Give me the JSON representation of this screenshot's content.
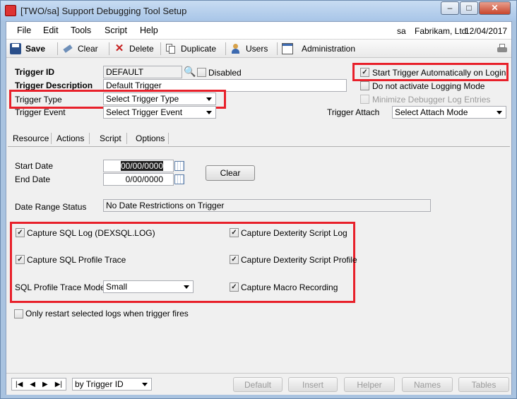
{
  "window": {
    "title": "[TWO/sa] Support Debugging Tool Setup",
    "controls": {
      "minimize": "–",
      "maximize": "□",
      "close": "✕"
    }
  },
  "menu": {
    "items": [
      "File",
      "Edit",
      "Tools",
      "Script",
      "Help"
    ],
    "user": "sa",
    "company": "Fabrikam, Ltd.",
    "date": "12/04/2017"
  },
  "toolbar": {
    "save": "Save",
    "clear": "Clear",
    "delete": "Delete",
    "duplicate": "Duplicate",
    "users": "Users",
    "administration": "Administration"
  },
  "header": {
    "trigger_id_label": "Trigger ID",
    "trigger_id_value": "DEFAULT",
    "disabled_label": "Disabled",
    "trigger_description_label": "Trigger Description",
    "trigger_description_value": "Default Trigger",
    "trigger_type_label": "Trigger Type",
    "trigger_type_value": "Select Trigger Type",
    "trigger_event_label": "Trigger Event",
    "trigger_event_value": "Select Trigger Event",
    "trigger_attach_label": "Trigger Attach",
    "trigger_attach_value": "Select Attach Mode",
    "start_auto_label": "Start Trigger Automatically on Login",
    "start_auto_checked": true,
    "no_logging_label": "Do not activate Logging Mode",
    "no_logging_checked": false,
    "minimize_log_label": "Minimize Debugger Log Entries",
    "minimize_log_checked": false
  },
  "tabs": [
    "Resource",
    "Actions",
    "Script",
    "Options"
  ],
  "options": {
    "start_date_label": "Start Date",
    "start_date_value": "00/00/0000",
    "end_date_label": "End Date",
    "end_date_value": "0/00/0000",
    "clear_button": "Clear",
    "date_range_label": "Date Range Status",
    "date_range_value": "No Date Restrictions on Trigger",
    "capture_sql_log": "Capture SQL Log (DEXSQL.LOG)",
    "capture_sql_profile": "Capture SQL Profile Trace",
    "sql_profile_mode_label": "SQL Profile Trace Mode",
    "sql_profile_mode_value": "Small",
    "capture_dex_log": "Capture Dexterity Script Log",
    "capture_dex_profile": "Capture Dexterity Script Profile",
    "capture_macro": "Capture Macro Recording",
    "only_restart": "Only restart selected logs when trigger fires"
  },
  "footer": {
    "sort_value": "by Trigger ID",
    "buttons": [
      "Default",
      "Insert",
      "Helper",
      "Names",
      "Tables"
    ]
  },
  "colors": {
    "highlight": "#e8202a"
  }
}
